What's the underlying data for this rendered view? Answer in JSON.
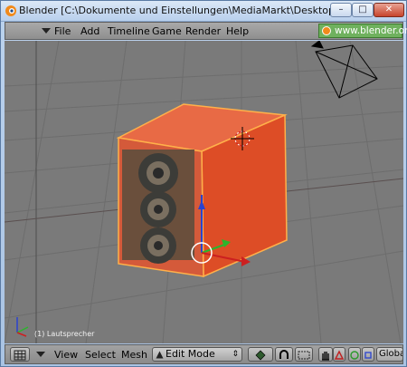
{
  "window": {
    "title": "Blender [C:\\Dokumente und Einstellungen\\MediaMarkt\\Desktop\\Irrlicht-Wik...",
    "min_glyph": "–",
    "max_glyph": "□",
    "close_glyph": "✕"
  },
  "menubar": {
    "items": [
      "File",
      "Add",
      "Timeline",
      "Game",
      "Render",
      "Help"
    ],
    "link": "www.blender.org"
  },
  "viewport": {
    "layer_label": "(1) Lautsprecher",
    "background_color": "#7a7a7a",
    "object_color": "#e0522b"
  },
  "bottombar": {
    "view": "View",
    "select": "Select",
    "mesh": "Mesh",
    "mode": "Edit Mode",
    "orientation": "Global"
  },
  "icons": [
    "blender-app-icon",
    "grid-menu-icon",
    "mode-icon",
    "pivot-icon",
    "snap-icon",
    "hand-icon",
    "triangle-icon",
    "circle-icon",
    "square-icon"
  ]
}
